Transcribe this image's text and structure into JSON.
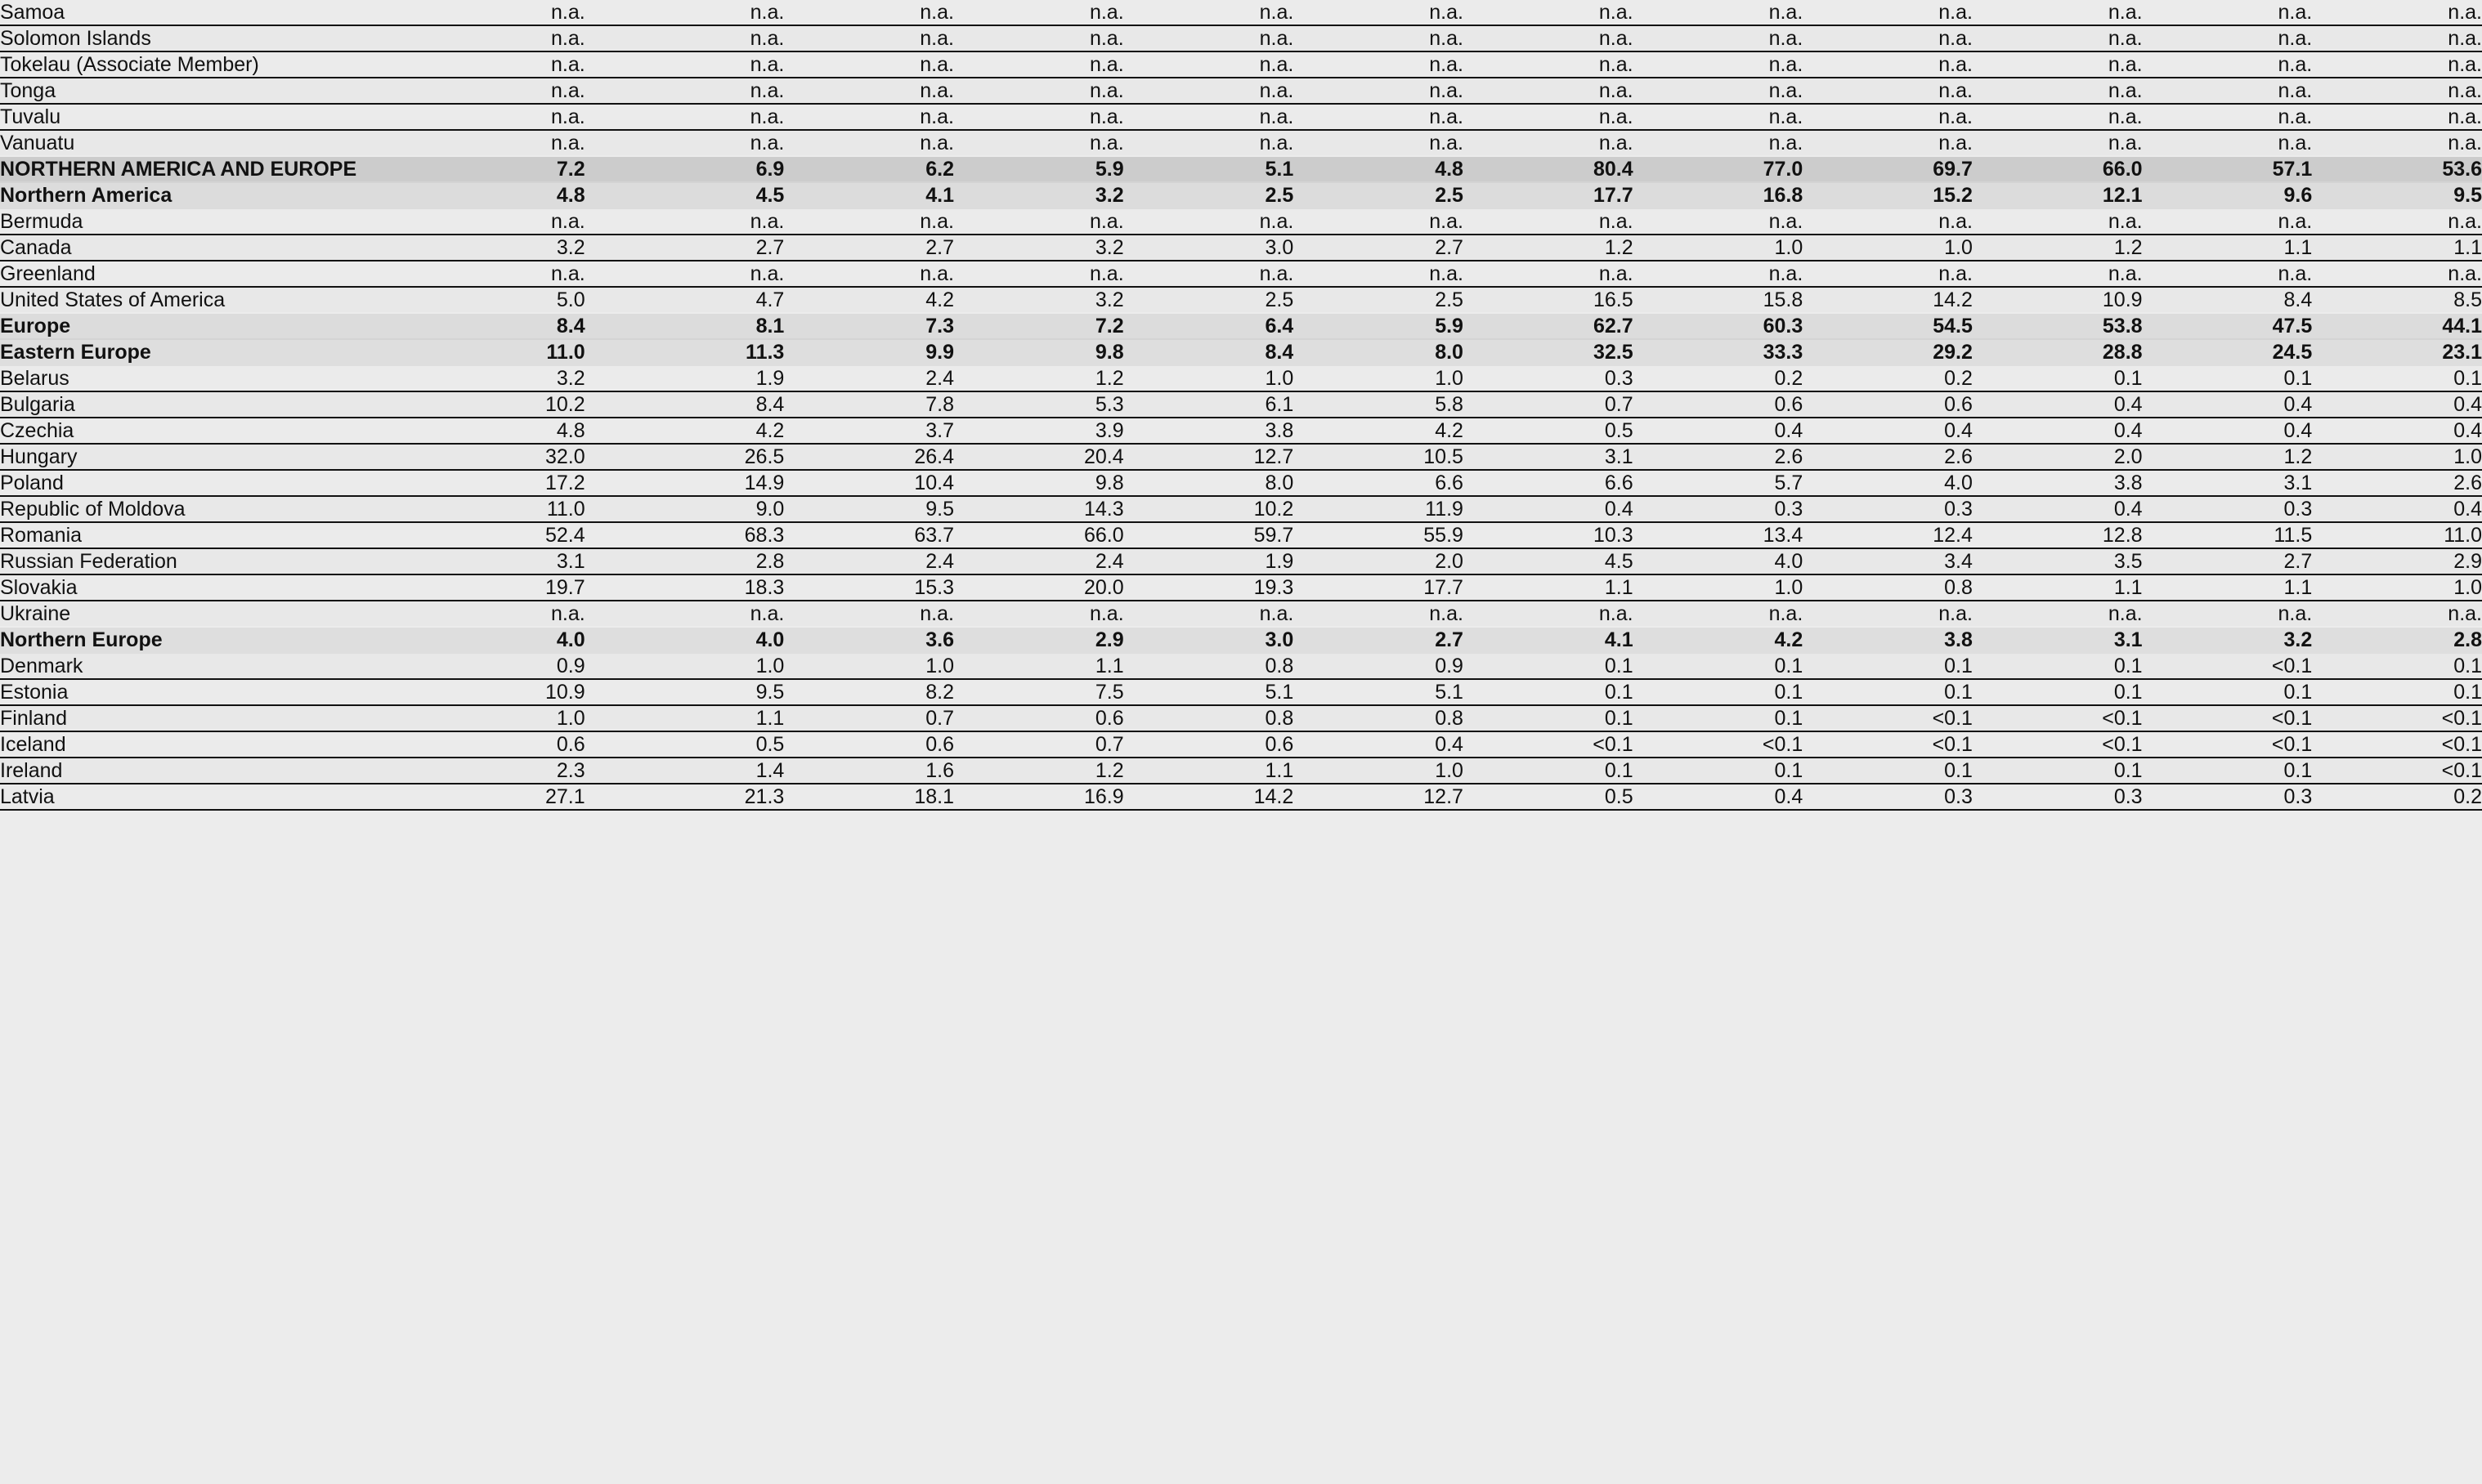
{
  "table": {
    "name_column_header": "",
    "column_count": 13,
    "rows": [
      {
        "label": "Samoa",
        "level": "country",
        "values": [
          "n.a.",
          "n.a.",
          "n.a.",
          "n.a.",
          "n.a.",
          "n.a.",
          "n.a.",
          "n.a.",
          "n.a.",
          "n.a.",
          "n.a.",
          "n.a."
        ]
      },
      {
        "label": "Solomon Islands",
        "level": "country",
        "values": [
          "n.a.",
          "n.a.",
          "n.a.",
          "n.a.",
          "n.a.",
          "n.a.",
          "n.a.",
          "n.a.",
          "n.a.",
          "n.a.",
          "n.a.",
          "n.a."
        ]
      },
      {
        "label": "Tokelau (Associate Member)",
        "level": "country",
        "values": [
          "n.a.",
          "n.a.",
          "n.a.",
          "n.a.",
          "n.a.",
          "n.a.",
          "n.a.",
          "n.a.",
          "n.a.",
          "n.a.",
          "n.a.",
          "n.a."
        ]
      },
      {
        "label": "Tonga",
        "level": "country",
        "values": [
          "n.a.",
          "n.a.",
          "n.a.",
          "n.a.",
          "n.a.",
          "n.a.",
          "n.a.",
          "n.a.",
          "n.a.",
          "n.a.",
          "n.a.",
          "n.a."
        ]
      },
      {
        "label": "Tuvalu",
        "level": "country",
        "values": [
          "n.a.",
          "n.a.",
          "n.a.",
          "n.a.",
          "n.a.",
          "n.a.",
          "n.a.",
          "n.a.",
          "n.a.",
          "n.a.",
          "n.a.",
          "n.a."
        ]
      },
      {
        "label": "Vanuatu",
        "level": "country",
        "values": [
          "n.a.",
          "n.a.",
          "n.a.",
          "n.a.",
          "n.a.",
          "n.a.",
          "n.a.",
          "n.a.",
          "n.a.",
          "n.a.",
          "n.a.",
          "n.a."
        ]
      },
      {
        "label": "NORTHERN AMERICA AND EUROPE",
        "level": "region",
        "values": [
          "7.2",
          "6.9",
          "6.2",
          "5.9",
          "5.1",
          "4.8",
          "80.4",
          "77.0",
          "69.7",
          "66.0",
          "57.1",
          "53.6"
        ]
      },
      {
        "label": "Northern America",
        "level": "subregion",
        "values": [
          "4.8",
          "4.5",
          "4.1",
          "3.2",
          "2.5",
          "2.5",
          "17.7",
          "16.8",
          "15.2",
          "12.1",
          "9.6",
          "9.5"
        ]
      },
      {
        "label": "Bermuda",
        "level": "country",
        "values": [
          "n.a.",
          "n.a.",
          "n.a.",
          "n.a.",
          "n.a.",
          "n.a.",
          "n.a.",
          "n.a.",
          "n.a.",
          "n.a.",
          "n.a.",
          "n.a."
        ]
      },
      {
        "label": "Canada",
        "level": "country",
        "values": [
          "3.2",
          "2.7",
          "2.7",
          "3.2",
          "3.0",
          "2.7",
          "1.2",
          "1.0",
          "1.0",
          "1.2",
          "1.1",
          "1.1"
        ]
      },
      {
        "label": "Greenland",
        "level": "country",
        "values": [
          "n.a.",
          "n.a.",
          "n.a.",
          "n.a.",
          "n.a.",
          "n.a.",
          "n.a.",
          "n.a.",
          "n.a.",
          "n.a.",
          "n.a.",
          "n.a."
        ]
      },
      {
        "label": "United States of America",
        "level": "country",
        "values": [
          "5.0",
          "4.7",
          "4.2",
          "3.2",
          "2.5",
          "2.5",
          "16.5",
          "15.8",
          "14.2",
          "10.9",
          "8.4",
          "8.5"
        ]
      },
      {
        "label": "Europe",
        "level": "subregion",
        "values": [
          "8.4",
          "8.1",
          "7.3",
          "7.2",
          "6.4",
          "5.9",
          "62.7",
          "60.3",
          "54.5",
          "53.8",
          "47.5",
          "44.1"
        ]
      },
      {
        "label": "Eastern Europe",
        "level": "subsubregion",
        "values": [
          "11.0",
          "11.3",
          "9.9",
          "9.8",
          "8.4",
          "8.0",
          "32.5",
          "33.3",
          "29.2",
          "28.8",
          "24.5",
          "23.1"
        ]
      },
      {
        "label": "Belarus",
        "level": "country",
        "values": [
          "3.2",
          "1.9",
          "2.4",
          "1.2",
          "1.0",
          "1.0",
          "0.3",
          "0.2",
          "0.2",
          "0.1",
          "0.1",
          "0.1"
        ]
      },
      {
        "label": "Bulgaria",
        "level": "country",
        "values": [
          "10.2",
          "8.4",
          "7.8",
          "5.3",
          "6.1",
          "5.8",
          "0.7",
          "0.6",
          "0.6",
          "0.4",
          "0.4",
          "0.4"
        ]
      },
      {
        "label": "Czechia",
        "level": "country",
        "values": [
          "4.8",
          "4.2",
          "3.7",
          "3.9",
          "3.8",
          "4.2",
          "0.5",
          "0.4",
          "0.4",
          "0.4",
          "0.4",
          "0.4"
        ]
      },
      {
        "label": "Hungary",
        "level": "country",
        "values": [
          "32.0",
          "26.5",
          "26.4",
          "20.4",
          "12.7",
          "10.5",
          "3.1",
          "2.6",
          "2.6",
          "2.0",
          "1.2",
          "1.0"
        ]
      },
      {
        "label": "Poland",
        "level": "country",
        "values": [
          "17.2",
          "14.9",
          "10.4",
          "9.8",
          "8.0",
          "6.6",
          "6.6",
          "5.7",
          "4.0",
          "3.8",
          "3.1",
          "2.6"
        ]
      },
      {
        "label": "Republic of Moldova",
        "level": "country",
        "values": [
          "11.0",
          "9.0",
          "9.5",
          "14.3",
          "10.2",
          "11.9",
          "0.4",
          "0.3",
          "0.3",
          "0.4",
          "0.3",
          "0.4"
        ]
      },
      {
        "label": "Romania",
        "level": "country",
        "values": [
          "52.4",
          "68.3",
          "63.7",
          "66.0",
          "59.7",
          "55.9",
          "10.3",
          "13.4",
          "12.4",
          "12.8",
          "11.5",
          "11.0"
        ]
      },
      {
        "label": "Russian Federation",
        "level": "country",
        "values": [
          "3.1",
          "2.8",
          "2.4",
          "2.4",
          "1.9",
          "2.0",
          "4.5",
          "4.0",
          "3.4",
          "3.5",
          "2.7",
          "2.9"
        ]
      },
      {
        "label": "Slovakia",
        "level": "country",
        "values": [
          "19.7",
          "18.3",
          "15.3",
          "20.0",
          "19.3",
          "17.7",
          "1.1",
          "1.0",
          "0.8",
          "1.1",
          "1.1",
          "1.0"
        ]
      },
      {
        "label": "Ukraine",
        "level": "country",
        "values": [
          "n.a.",
          "n.a.",
          "n.a.",
          "n.a.",
          "n.a.",
          "n.a.",
          "n.a.",
          "n.a.",
          "n.a.",
          "n.a.",
          "n.a.",
          "n.a."
        ]
      },
      {
        "label": "Northern Europe",
        "level": "subsubregion",
        "values": [
          "4.0",
          "4.0",
          "3.6",
          "2.9",
          "3.0",
          "2.7",
          "4.1",
          "4.2",
          "3.8",
          "3.1",
          "3.2",
          "2.8"
        ]
      },
      {
        "label": "Denmark",
        "level": "country",
        "values": [
          "0.9",
          "1.0",
          "1.0",
          "1.1",
          "0.8",
          "0.9",
          "0.1",
          "0.1",
          "0.1",
          "0.1",
          "<0.1",
          "0.1"
        ]
      },
      {
        "label": "Estonia",
        "level": "country",
        "values": [
          "10.9",
          "9.5",
          "8.2",
          "7.5",
          "5.1",
          "5.1",
          "0.1",
          "0.1",
          "0.1",
          "0.1",
          "0.1",
          "0.1"
        ]
      },
      {
        "label": "Finland",
        "level": "country",
        "values": [
          "1.0",
          "1.1",
          "0.7",
          "0.6",
          "0.8",
          "0.8",
          "0.1",
          "0.1",
          "<0.1",
          "<0.1",
          "<0.1",
          "<0.1"
        ]
      },
      {
        "label": "Iceland",
        "level": "country",
        "values": [
          "0.6",
          "0.5",
          "0.6",
          "0.7",
          "0.6",
          "0.4",
          "<0.1",
          "<0.1",
          "<0.1",
          "<0.1",
          "<0.1",
          "<0.1"
        ]
      },
      {
        "label": "Ireland",
        "level": "country",
        "values": [
          "2.3",
          "1.4",
          "1.6",
          "1.2",
          "1.1",
          "1.0",
          "0.1",
          "0.1",
          "0.1",
          "0.1",
          "0.1",
          "<0.1"
        ]
      },
      {
        "label": "Latvia",
        "level": "country",
        "values": [
          "27.1",
          "21.3",
          "18.1",
          "16.9",
          "14.2",
          "12.7",
          "0.5",
          "0.4",
          "0.3",
          "0.3",
          "0.3",
          "0.2"
        ]
      }
    ]
  },
  "colors": {
    "page_background": "#ececec",
    "row_background": "#ebebeb",
    "row_background_alt": "#e8e8e8",
    "region_background": "#cccccc",
    "subregion_background": "#dcdcdc",
    "subsubregion_background": "#dedede",
    "rule_color": "#111111",
    "text_color": "#111111"
  }
}
